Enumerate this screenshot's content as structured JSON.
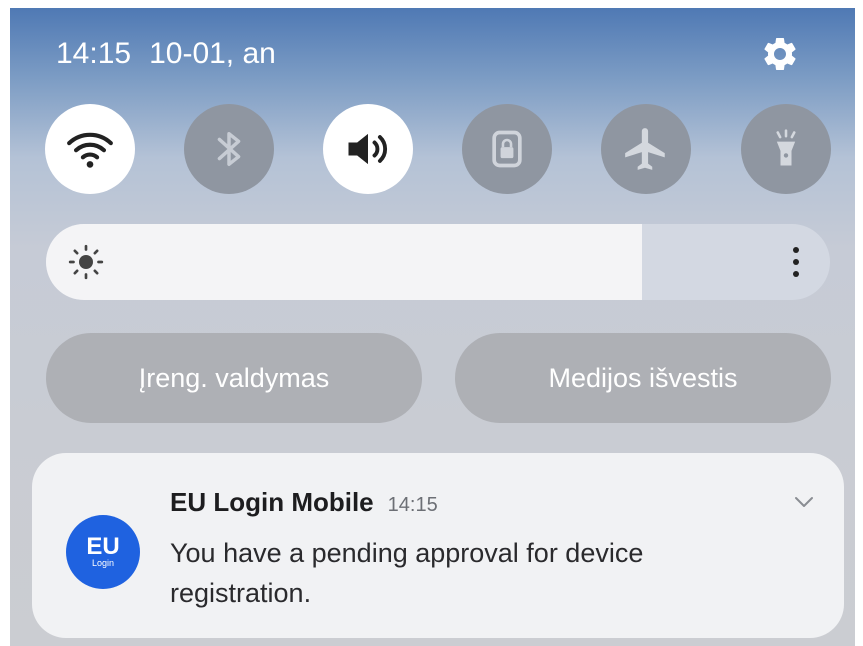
{
  "status": {
    "time": "14:15",
    "date": "10-01, an"
  },
  "quick_tiles": [
    {
      "icon": "wifi-icon",
      "state": "on"
    },
    {
      "icon": "bluetooth-icon",
      "state": "off"
    },
    {
      "icon": "sound-icon",
      "state": "on"
    },
    {
      "icon": "lock-icon",
      "state": "off"
    },
    {
      "icon": "airplane-icon",
      "state": "off"
    },
    {
      "icon": "flashlight-icon",
      "state": "off"
    }
  ],
  "brightness": {
    "level_percent": 76
  },
  "buttons": {
    "device_control": "Įreng. valdymas",
    "media_output": "Medijos išvestis"
  },
  "notification": {
    "app_name": "EU Login Mobile",
    "time": "14:15",
    "body": "You have a pending approval for device registration.",
    "icon_text_big": "EU",
    "icon_text_small": "Login",
    "icon_color": "#1f62e0"
  },
  "colors": {
    "tile_on": "#ffffff",
    "tile_off": "#8f96a1",
    "pill": "#aeb0b5"
  }
}
